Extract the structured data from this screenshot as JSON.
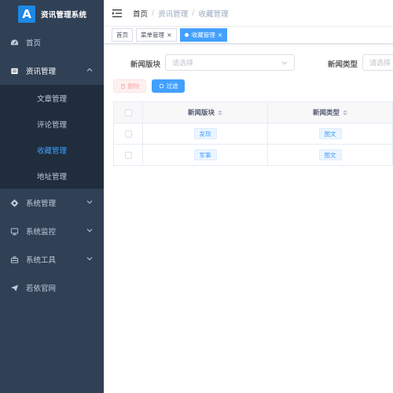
{
  "app": {
    "logo_letter": "A",
    "title": "资讯管理系统"
  },
  "sidebar": {
    "items": [
      {
        "label": "首页",
        "icon": "dashboard-icon"
      },
      {
        "label": "资讯管理",
        "icon": "article-icon",
        "expanded": true
      },
      {
        "label": "系统管理",
        "icon": "gear-icon"
      },
      {
        "label": "系统监控",
        "icon": "monitor-icon"
      },
      {
        "label": "系统工具",
        "icon": "toolbox-icon"
      },
      {
        "label": "若依官网",
        "icon": "send-icon"
      }
    ],
    "submenu": [
      {
        "label": "文章管理"
      },
      {
        "label": "评论管理"
      },
      {
        "label": "收藏管理",
        "active": true
      },
      {
        "label": "地址管理"
      }
    ]
  },
  "breadcrumb": {
    "home": "首页",
    "section": "资讯管理",
    "current": "收藏管理",
    "sep": "/"
  },
  "tags": [
    {
      "label": "首页"
    },
    {
      "label": "菜单管理",
      "close": "×"
    },
    {
      "label": "收藏管理",
      "close": "×",
      "active": true
    }
  ],
  "filters": {
    "section_label": "新闻版块",
    "section_placeholder": "请选择",
    "type_label": "新闻类型",
    "type_placeholder": "请选择"
  },
  "buttons": {
    "delete": "删除",
    "filter": "过滤"
  },
  "table": {
    "columns": [
      "新闻版块",
      "新闻类型"
    ],
    "rows": [
      {
        "section": "发现",
        "type": "图文"
      },
      {
        "section": "军事",
        "type": "图文"
      }
    ]
  },
  "colors": {
    "sidebar_bg": "#304156",
    "submenu_bg": "#1f2d3d",
    "accent": "#409eff",
    "tag_active": "#42a0ff"
  }
}
